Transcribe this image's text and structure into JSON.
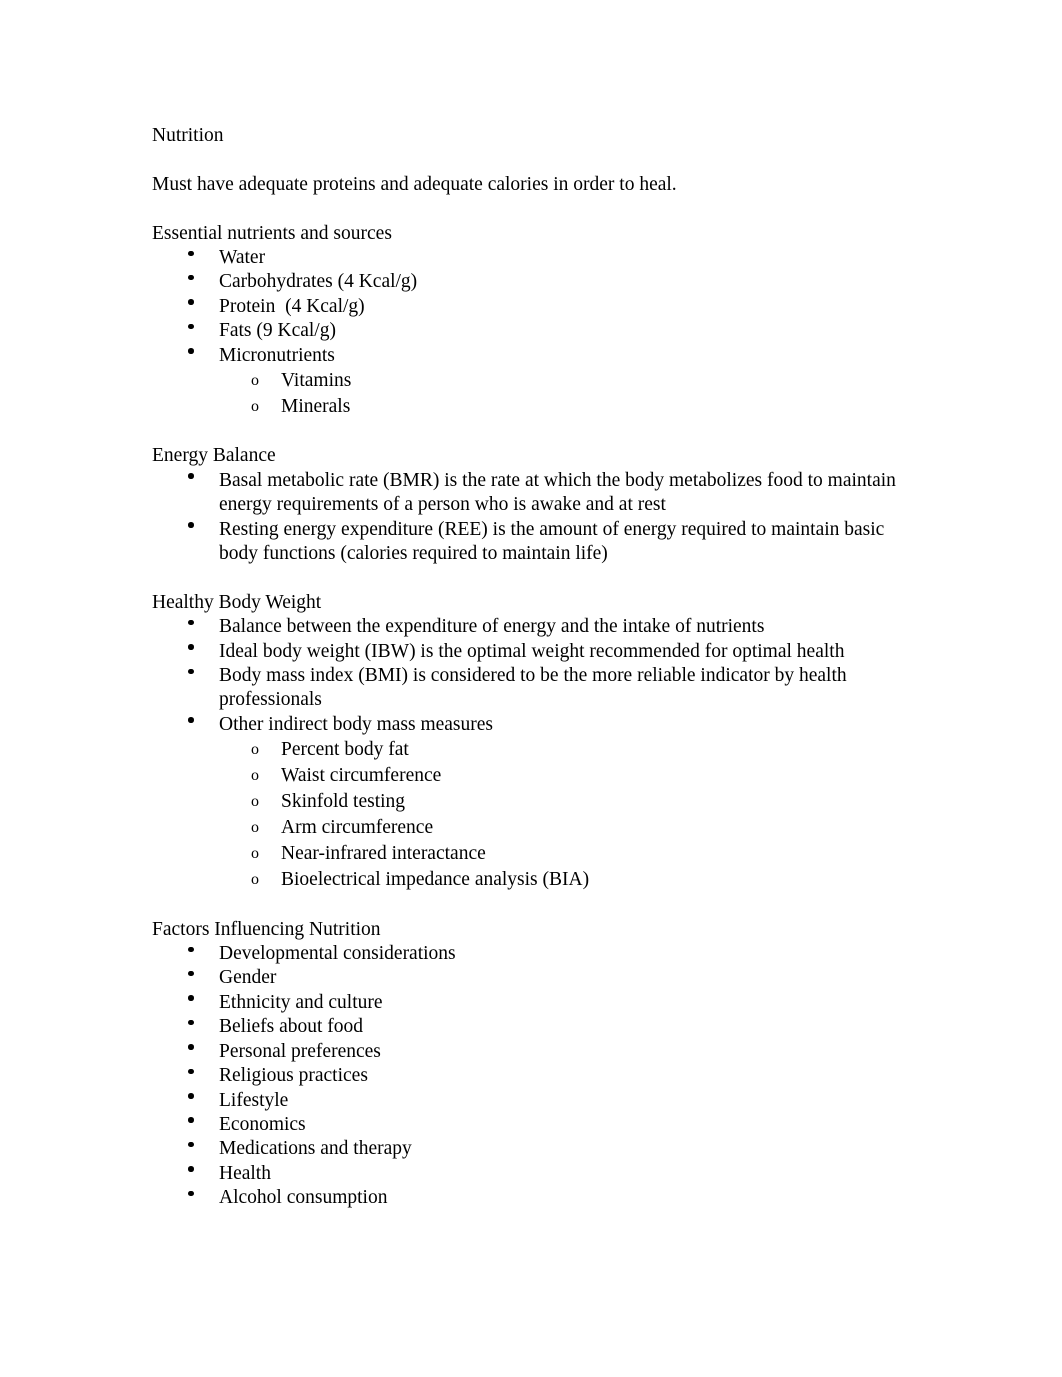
{
  "document": {
    "title": "Nutrition",
    "page_background": "#ffffff",
    "text_color": "#000000",
    "blocks": [
      {
        "type": "paragraph",
        "text": "Nutrition"
      },
      {
        "type": "paragraph",
        "text": "Must have adequate proteins and adequate calories in order to heal."
      },
      {
        "type": "heading",
        "text": "Essential nutrients and sources"
      },
      {
        "type": "list",
        "items": [
          {
            "level": 1,
            "marker": "bullet-dot",
            "text": "Water"
          },
          {
            "level": 1,
            "marker": "bullet-dot",
            "text": "Carbohydrates (4 Kcal/g)"
          },
          {
            "level": 1,
            "marker": "bullet-dot",
            "text": "Protein  (4 Kcal/g)"
          },
          {
            "level": 1,
            "marker": "bullet-dot",
            "text": "Fats (9 Kcal/g)"
          },
          {
            "level": 1,
            "marker": "bullet-dot",
            "text": "Micronutrients"
          },
          {
            "level": 2,
            "marker": "bullet-o",
            "text": "Vitamins"
          },
          {
            "level": 2,
            "marker": "bullet-o",
            "text": "Minerals"
          }
        ]
      },
      {
        "type": "heading",
        "text": "Energy Balance"
      },
      {
        "type": "list",
        "items": [
          {
            "level": 1,
            "marker": "bullet-dot",
            "text": "Basal metabolic rate (BMR) is the rate at which the body metabolizes food to maintain energy requirements of a person who is awake and at rest"
          },
          {
            "level": 1,
            "marker": "bullet-dot",
            "text": "Resting energy expenditure (REE) is the amount of energy required to maintain basic body functions (calories required to maintain life)"
          }
        ]
      },
      {
        "type": "heading",
        "text": "Healthy Body Weight"
      },
      {
        "type": "list",
        "items": [
          {
            "level": 1,
            "marker": "bullet-dot",
            "text": "Balance between the expenditure of energy and the intake of nutrients"
          },
          {
            "level": 1,
            "marker": "bullet-dot",
            "text": "Ideal body weight (IBW) is the optimal weight recommended for optimal health"
          },
          {
            "level": 1,
            "marker": "bullet-dot",
            "text": "Body mass index (BMI) is considered to be the more reliable indicator by health professionals"
          },
          {
            "level": 1,
            "marker": "bullet-dot",
            "text": "Other indirect body mass measures"
          },
          {
            "level": 2,
            "marker": "bullet-o",
            "text": "Percent body fat"
          },
          {
            "level": 2,
            "marker": "bullet-o",
            "text": "Waist circumference"
          },
          {
            "level": 2,
            "marker": "bullet-o",
            "text": "Skinfold testing"
          },
          {
            "level": 2,
            "marker": "bullet-o",
            "text": "Arm circumference"
          },
          {
            "level": 2,
            "marker": "bullet-o",
            "text": "Near-infrared interactance"
          },
          {
            "level": 2,
            "marker": "bullet-o",
            "text": "Bioelectrical impedance analysis (BIA)"
          }
        ]
      },
      {
        "type": "heading",
        "text": "Factors Influencing Nutrition"
      },
      {
        "type": "list",
        "items": [
          {
            "level": 1,
            "marker": "bullet-dot",
            "text": "Developmental considerations"
          },
          {
            "level": 1,
            "marker": "bullet-dot",
            "text": "Gender"
          },
          {
            "level": 1,
            "marker": "bullet-dot",
            "text": "Ethnicity and culture"
          },
          {
            "level": 1,
            "marker": "bullet-dot",
            "text": "Beliefs about food"
          },
          {
            "level": 1,
            "marker": "bullet-dot",
            "text": "Personal preferences"
          },
          {
            "level": 1,
            "marker": "bullet-dot",
            "text": "Religious practices"
          },
          {
            "level": 1,
            "marker": "bullet-dot",
            "text": "Lifestyle"
          },
          {
            "level": 1,
            "marker": "bullet-dot",
            "text": "Economics"
          },
          {
            "level": 1,
            "marker": "bullet-dot",
            "text": "Medications and therapy"
          },
          {
            "level": 1,
            "marker": "bullet-dot",
            "text": "Health"
          },
          {
            "level": 1,
            "marker": "bullet-dot",
            "text": "Alcohol consumption"
          }
        ]
      }
    ],
    "marker_glyphs": {
      "bullet-o": "o"
    }
  }
}
